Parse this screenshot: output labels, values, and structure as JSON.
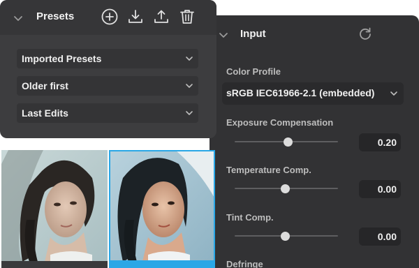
{
  "presets": {
    "title": "Presets",
    "header_icons": [
      "add-circle-icon",
      "download-icon",
      "upload-icon",
      "trash-icon"
    ],
    "dropdowns": [
      {
        "label": "Imported Presets"
      },
      {
        "label": "Older first"
      },
      {
        "label": "Last Edits"
      }
    ]
  },
  "input": {
    "title": "Input",
    "color_profile": {
      "label": "Color Profile",
      "value": "sRGB IEC61966-2.1 (embedded)"
    },
    "sliders": [
      {
        "label": "Exposure Compensation",
        "value": "0.20",
        "position": 0.52
      },
      {
        "label": "Temperature Comp.",
        "value": "0.00",
        "position": 0.49
      },
      {
        "label": "Tint Comp.",
        "value": "0.00",
        "position": 0.49
      }
    ],
    "next_section": "Defringe"
  },
  "colors": {
    "panel": "#323234",
    "presets_panel": "#3d3d3f",
    "accent": "#2aa7e6"
  }
}
